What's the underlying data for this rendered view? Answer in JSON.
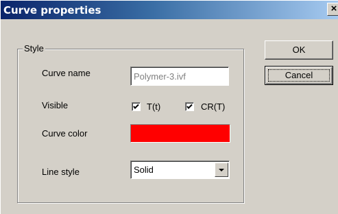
{
  "window": {
    "title": "Curve properties",
    "close_glyph": "×"
  },
  "group": {
    "legend": "Style"
  },
  "fields": {
    "curve_name_label": "Curve name",
    "curve_name_value": "Polymer-3.ivf",
    "visible_label": "Visible",
    "t_checkbox_label": "T(t)",
    "t_checked": true,
    "cr_checkbox_label": "CR(T)",
    "cr_checked": true,
    "curve_color_label": "Curve color",
    "curve_color": "#ff0000",
    "line_style_label": "Line style",
    "line_style_value": "Solid"
  },
  "buttons": {
    "ok": "OK",
    "cancel": "Cancel"
  },
  "colors": {
    "dialog_bg": "#d4d0c8",
    "title_start": "#0a246a",
    "title_end": "#a6caf0"
  }
}
